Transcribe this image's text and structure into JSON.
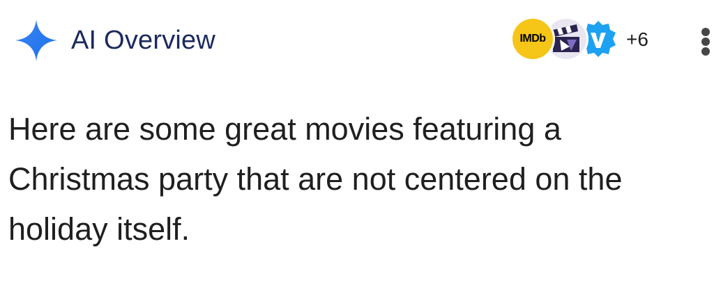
{
  "header": {
    "title": "AI Overview",
    "sparkle_icon": "gemini-sparkle-icon",
    "sparkle_color": "#4285f4",
    "sources": [
      {
        "name": "IMDb",
        "icon": "imdb-logo-icon",
        "label": "IMDb",
        "color": "#f5c518"
      },
      {
        "name": "clapperboard",
        "icon": "film-clapper-icon",
        "color": "#5b4a8b"
      },
      {
        "name": "verified",
        "icon": "verified-check-icon",
        "color": "#1da1f2"
      }
    ],
    "more_sources": "+6",
    "menu_icon": "more-vert-icon"
  },
  "overview": {
    "lines": [
      "Here are some great movies featuring a",
      "Christmas party that are not centered on the",
      "holiday itself."
    ]
  }
}
